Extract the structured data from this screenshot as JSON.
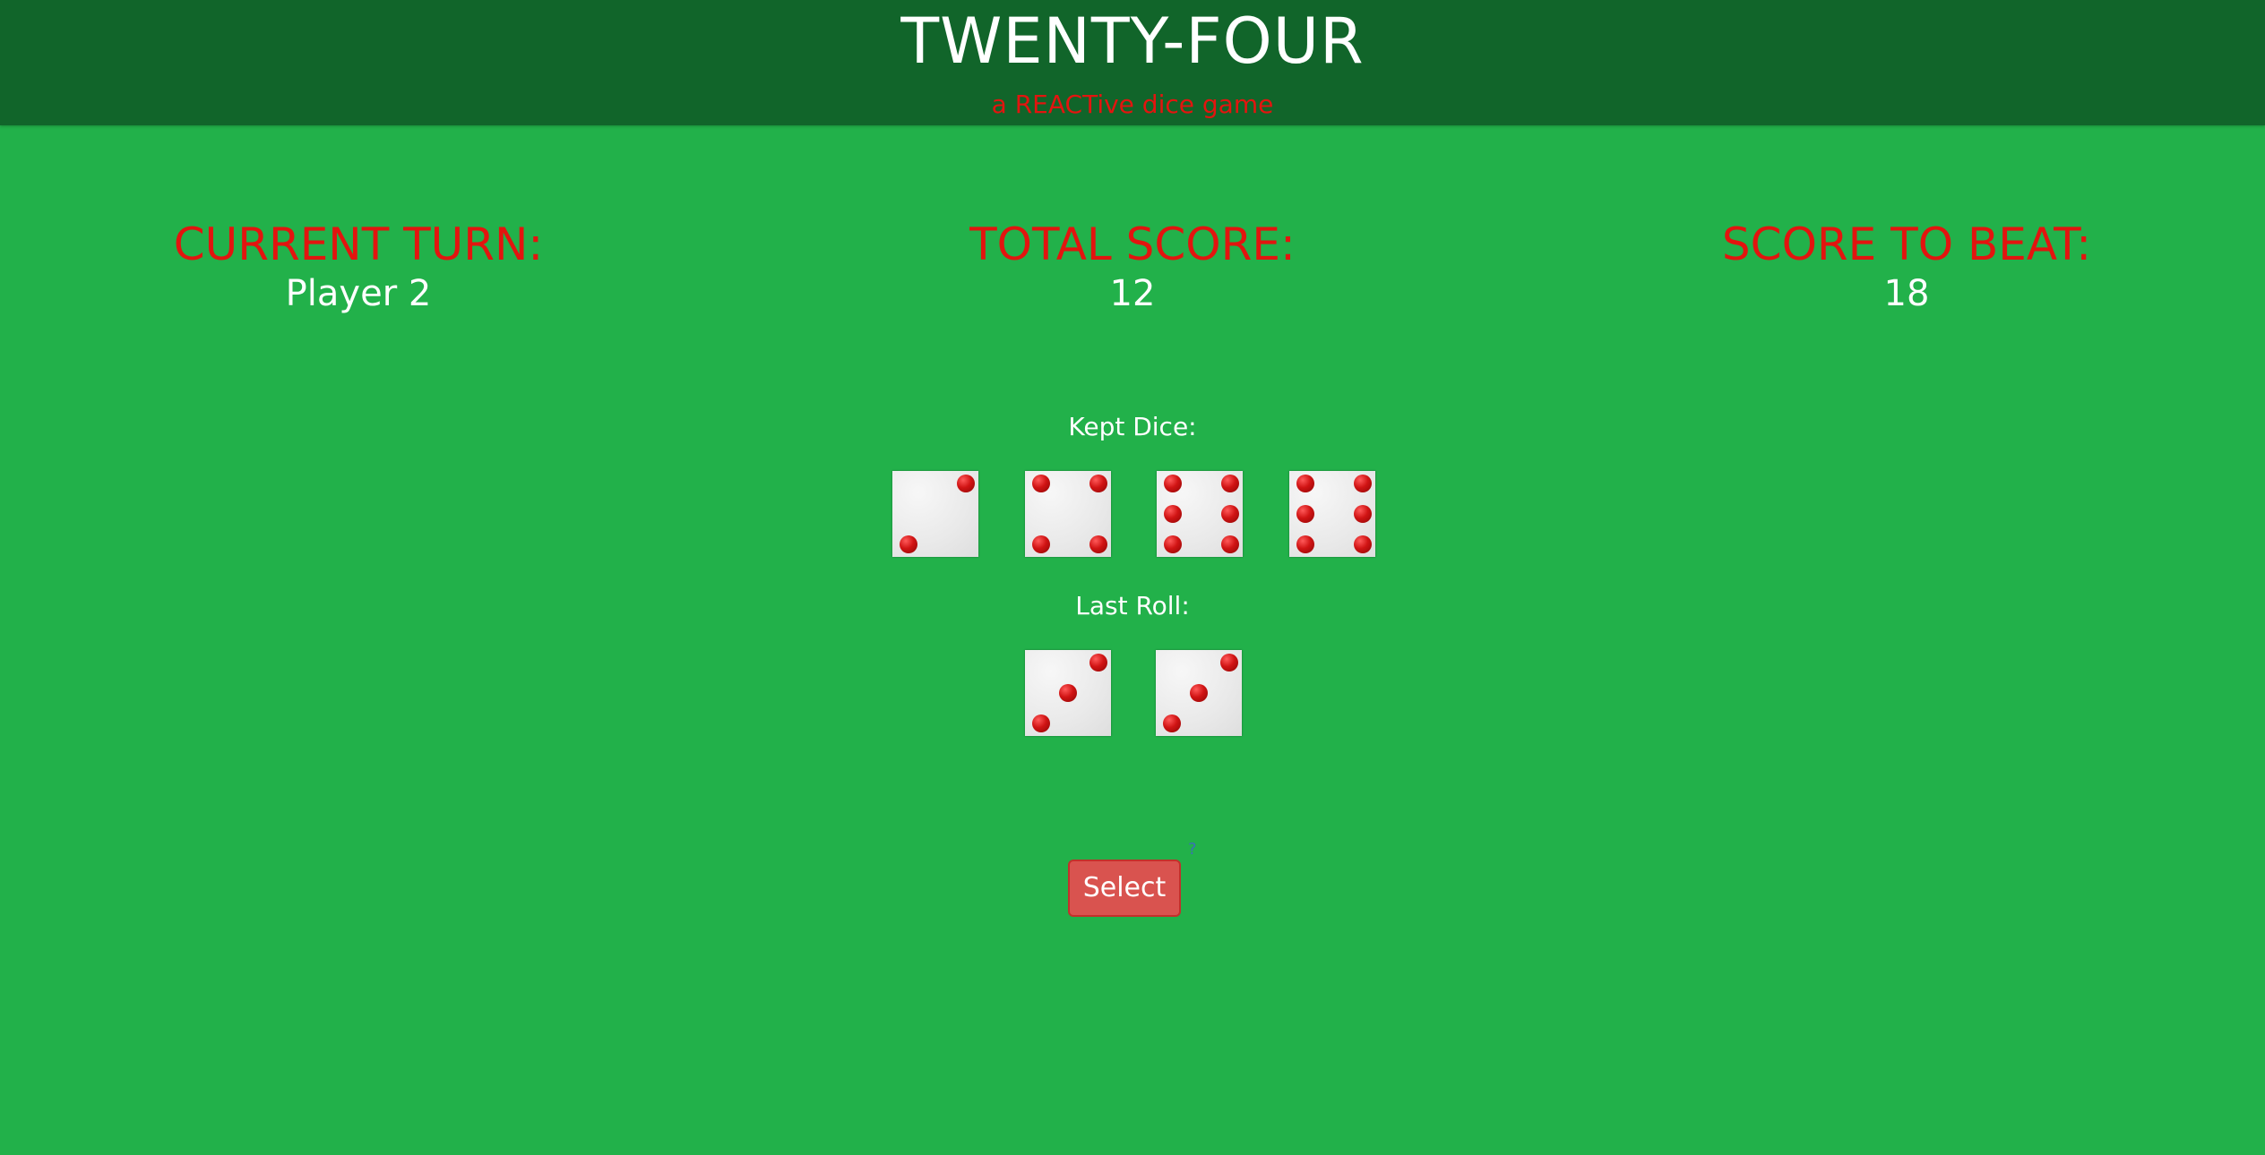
{
  "header": {
    "title": "TWENTY-FOUR",
    "subtitle": "a REACTive dice game"
  },
  "stats": {
    "current_turn": {
      "label": "CURRENT TURN:",
      "value": "Player 2"
    },
    "total_score": {
      "label": "TOTAL SCORE:",
      "value": "12"
    },
    "score_to_beat": {
      "label": "SCORE TO BEAT:",
      "value": "18"
    }
  },
  "kept_dice": {
    "label": "Kept Dice:",
    "values": [
      2,
      4,
      6,
      6
    ]
  },
  "last_roll": {
    "label": "Last Roll:",
    "values": [
      3,
      3
    ]
  },
  "actions": {
    "select_label": "Select",
    "help_label": "?"
  },
  "colors": {
    "background": "#22b14a",
    "header": "#11652a",
    "accent_red": "#e3140f",
    "button": "#d9534f"
  }
}
